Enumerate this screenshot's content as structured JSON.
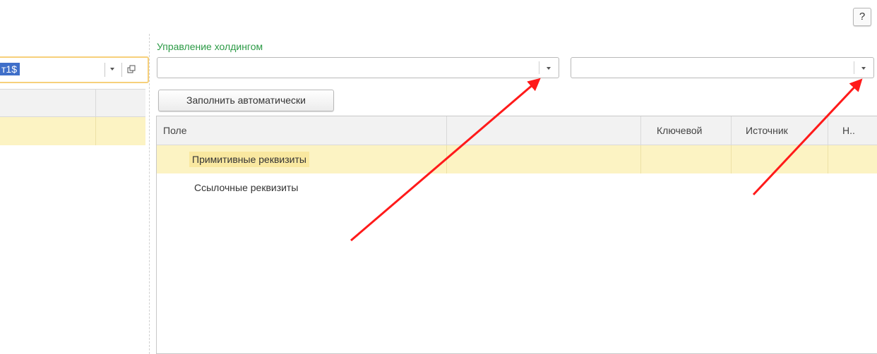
{
  "help": {
    "label": "?"
  },
  "left_panel": {
    "combo_selected_text": "т1$"
  },
  "group": {
    "title": "Управление холдингом",
    "combo1_value": "",
    "combo2_value": ""
  },
  "toolbar": {
    "fill_auto_label": "Заполнить автоматически"
  },
  "grid": {
    "columns": [
      "Поле",
      "",
      "Ключевой",
      "Источник",
      "Н.."
    ],
    "rows": [
      {
        "label": "Примитивные реквизиты",
        "selected": true
      },
      {
        "label": "Ссылочные реквизиты",
        "selected": false
      }
    ]
  },
  "colors": {
    "group_title": "#2b9a45",
    "selection_row": "#fcf3c3",
    "focus_border": "#f7d07b",
    "annotation_arrow": "#ff1a1a"
  }
}
